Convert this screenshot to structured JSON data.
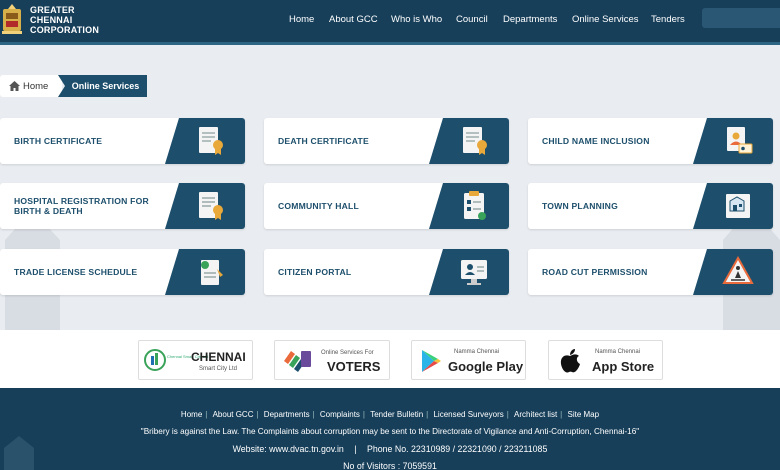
{
  "header": {
    "brand_line1": "GREATER",
    "brand_line2": "CHENNAI",
    "brand_line3": "CORPORATION",
    "nav": [
      "Home",
      "About GCC",
      "Who is Who",
      "Council",
      "Departments",
      "Online Services",
      "Tenders"
    ]
  },
  "breadcrumb": {
    "home": "Home",
    "current": "Online Services"
  },
  "services": [
    {
      "label": "BIRTH CERTIFICATE",
      "icon": "certificate-icon"
    },
    {
      "label": "DEATH CERTIFICATE",
      "icon": "certificate-icon"
    },
    {
      "label": "CHILD NAME INCLUSION",
      "icon": "id-card-icon"
    },
    {
      "label": "HOSPITAL REGISTRATION FOR BIRTH & DEATH",
      "icon": "certificate-icon"
    },
    {
      "label": "COMMUNITY HALL",
      "icon": "clipboard-icon"
    },
    {
      "label": "TOWN PLANNING",
      "icon": "blueprint-icon"
    },
    {
      "label": "TRADE LICENSE SCHEDULE",
      "icon": "license-icon"
    },
    {
      "label": "CITIZEN PORTAL",
      "icon": "monitor-user-icon"
    },
    {
      "label": "ROAD CUT PERMISSION",
      "icon": "warning-sign-icon"
    }
  ],
  "partners": {
    "chennai_small": "Chennai Smart City Ltd",
    "chennai_big": "CHENNAI",
    "chennai_sub": "Smart City Ltd",
    "voters_small": "Online Services For",
    "voters_big": "VOTERS",
    "play_small": "Namma Chennai",
    "play_big": "Google Play",
    "apple_small": "Namma Chennai",
    "apple_big": "App Store"
  },
  "footer": {
    "links": [
      "Home",
      "About GCC",
      "Departments",
      "Complaints",
      "Tender Bulletin",
      "Licensed Surveyors",
      "Architect list",
      "Site Map"
    ],
    "notice": "\"Bribery is against the Law. The Complaints about corruption may be sent to the Directorate of Vigilance and Anti-Corruption, Chennai-16\"",
    "website": "Website: www.dvac.tn.gov.in",
    "phone": "Phone No. 22310989 / 22321090 / 223211085",
    "visitors": "No of Visitors : 7059591"
  },
  "colors": {
    "header": "#173f5a",
    "accent": "#1d4f6c",
    "icon_gold": "#e9a83a",
    "page_bg": "#e9edf1"
  }
}
